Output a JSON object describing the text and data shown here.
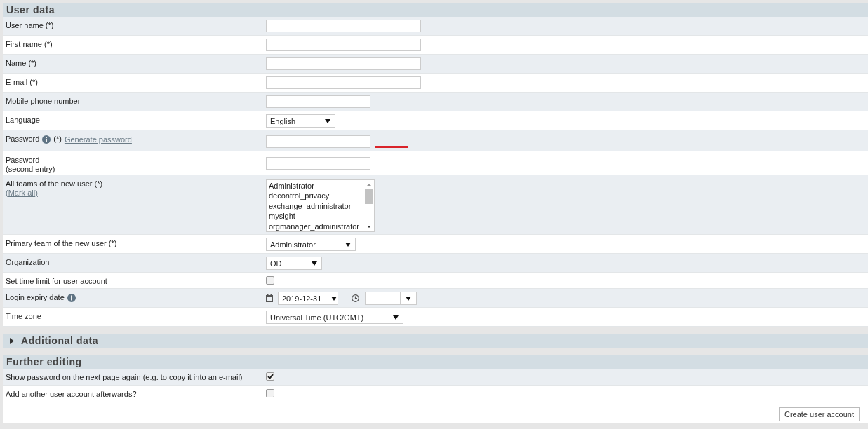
{
  "sections": [
    {
      "title": "User data",
      "rows": [
        {
          "kind": "text",
          "label": "User name (*)",
          "focused": true
        },
        {
          "kind": "text",
          "label": "First name (*)"
        },
        {
          "kind": "text",
          "label": "Name (*)"
        },
        {
          "kind": "text",
          "label": "E-mail (*)"
        },
        {
          "kind": "phone",
          "label": "Mobile phone number"
        },
        {
          "kind": "select",
          "label": "Language",
          "value": "English"
        },
        {
          "kind": "password",
          "label": "Password",
          "info": true,
          "suffix": "(*)",
          "link": "Generate password",
          "strength_bar": true
        },
        {
          "kind": "password",
          "label": "Password\n(second entry)"
        },
        {
          "kind": "listbox",
          "label": "All teams of the new user (*)",
          "link": "(Mark all)",
          "options": [
            {
              "label": "Administrator",
              "selected": false
            },
            {
              "label": "decontrol_privacy",
              "selected": false
            },
            {
              "label": "exchange_administrator",
              "selected": false
            },
            {
              "label": "mysight",
              "selected": false
            },
            {
              "label": "orgmanager_administrator",
              "selected": false
            }
          ]
        },
        {
          "kind": "select",
          "label": "Primary team of the new user (*)",
          "value": "Administrator"
        },
        {
          "kind": "select",
          "label": "Organization",
          "value": "OD"
        },
        {
          "kind": "checkbox",
          "label": "Set time limit for user account",
          "checked": false
        },
        {
          "kind": "datetime",
          "label": "Login expiry date",
          "info": true,
          "date": "2019-12-31"
        },
        {
          "kind": "select",
          "label": "Time zone",
          "value": "Universal Time (UTC/GMT)"
        }
      ]
    },
    {
      "title": "Additional data",
      "expanded": false
    },
    {
      "title": "Further editing",
      "rows": [
        {
          "kind": "checkbox",
          "label": "Show password on the next page again (e.g. to copy it into an e-mail)",
          "checked": true
        },
        {
          "kind": "checkbox",
          "label": "Add another user account afterwards?",
          "checked": false
        }
      ]
    }
  ],
  "submit": {
    "label": "Create user account"
  }
}
